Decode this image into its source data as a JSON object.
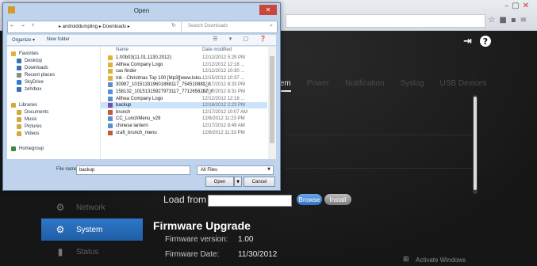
{
  "browser": {
    "controls": [
      "–",
      "▢",
      "✕"
    ],
    "right_icons": [
      "☆",
      "■",
      "▪",
      "≡"
    ]
  },
  "router": {
    "top_icons": [
      "⇥",
      "?"
    ],
    "tabs": [
      {
        "label": "stem",
        "active": true
      },
      {
        "label": "Power",
        "active": false
      },
      {
        "label": "Notification",
        "active": false
      },
      {
        "label": "Syslog",
        "active": false
      },
      {
        "label": "USB Devices",
        "active": false
      }
    ],
    "sidebar": [
      {
        "label": "Network",
        "icon": "network-icon",
        "glyph": "⚙",
        "active": false
      },
      {
        "label": "System",
        "icon": "system-gear-icon",
        "glyph": "⚙",
        "active": true
      },
      {
        "label": "Status",
        "icon": "status-bars-icon",
        "glyph": "▮",
        "active": false
      }
    ],
    "load_from": "Load from",
    "browse": "Browse",
    "install": "Install",
    "firmware_title": "Firmware Upgrade",
    "firmware_version_label": "Firmware version:",
    "firmware_version": "1.00",
    "firmware_date_label": "Firmware Date:",
    "firmware_date": "11/30/2012",
    "watermark": "Activate Windows"
  },
  "dialog": {
    "title": "Open",
    "close": "✕",
    "nav_arrows": "← → ↑",
    "breadcrumb": "▸ androiddumpling ▸ Downloads ▸",
    "refresh": "↻",
    "search_placeholder": "Search Downloads",
    "organize": "Organize ▾",
    "new_folder": "New folder",
    "toolbar_right": "☰ ▾ ▢ ❓",
    "nav_items": [
      {
        "label": "Favorites",
        "color": "#e2b23d"
      },
      {
        "label": "Desktop",
        "color": "#3c6fb3"
      },
      {
        "label": "Downloads",
        "color": "#3c6fb3"
      },
      {
        "label": "Recent places",
        "color": "#8a8a8a"
      },
      {
        "label": "SkyDrive",
        "color": "#2f7bd1"
      },
      {
        "label": "zehrbox",
        "color": "#3c6fb3"
      },
      {
        "label": "Libraries",
        "color": "#d6a640"
      },
      {
        "label": "Documents",
        "color": "#d6a640"
      },
      {
        "label": "Music",
        "color": "#d6a640"
      },
      {
        "label": "Pictures",
        "color": "#d6a640"
      },
      {
        "label": "Videos",
        "color": "#d6a640"
      },
      {
        "label": "Homegroup",
        "color": "#3f8a3f"
      }
    ],
    "col_name": "Name",
    "col_date": "Date modified",
    "files": [
      {
        "name": "1.00b03(11.01.1130.2012)",
        "date": "12/12/2012 5:29 PM",
        "color": "#e0b23a",
        "selected": false
      },
      {
        "name": "Althea Company Logo",
        "date": "12/12/2012 12:18 ...",
        "color": "#e0b23a",
        "selected": false
      },
      {
        "name": "cas finder",
        "date": "12/12/2012 10:30 ...",
        "color": "#e0b23a",
        "selected": false
      },
      {
        "name": "Ink - Christmas Top 100 [Mp3][www.loko...",
        "date": "12/15/2012 10:37 ...",
        "color": "#e0b23a",
        "selected": false
      },
      {
        "name": "30987_101513319601888117_754510881_n",
        "date": "12/17/2012 8:33 PM",
        "color": "#5b8fcf",
        "selected": false
      },
      {
        "name": "158132_10151315927973117_7712658287_n",
        "date": "12/17/2012 8:31 PM",
        "color": "#5b8fcf",
        "selected": false
      },
      {
        "name": "Althea Company Logo",
        "date": "12/12/2012 12:18 ...",
        "color": "#5b8fcf",
        "selected": false
      },
      {
        "name": "backup",
        "date": "12/18/2012 2:23 PM",
        "color": "#7a4f9e",
        "selected": true
      },
      {
        "name": "brunch",
        "date": "12/17/2012 10:07 AM",
        "color": "#c45a3a",
        "selected": false
      },
      {
        "name": "CC_LunchMenu_v29",
        "date": "12/6/2012 11:23 PM",
        "color": "#5b8fcf",
        "selected": false
      },
      {
        "name": "chinese lantern",
        "date": "12/17/2012 8:49 AM",
        "color": "#5b8fcf",
        "selected": false
      },
      {
        "name": "craft_brunch_menu",
        "date": "12/6/2012 11:33 PM",
        "color": "#c45a3a",
        "selected": false
      }
    ],
    "filename_label": "File name:",
    "filename_value": "backup",
    "filetype": "All Files",
    "open": "Open",
    "cancel": "Cancel"
  }
}
